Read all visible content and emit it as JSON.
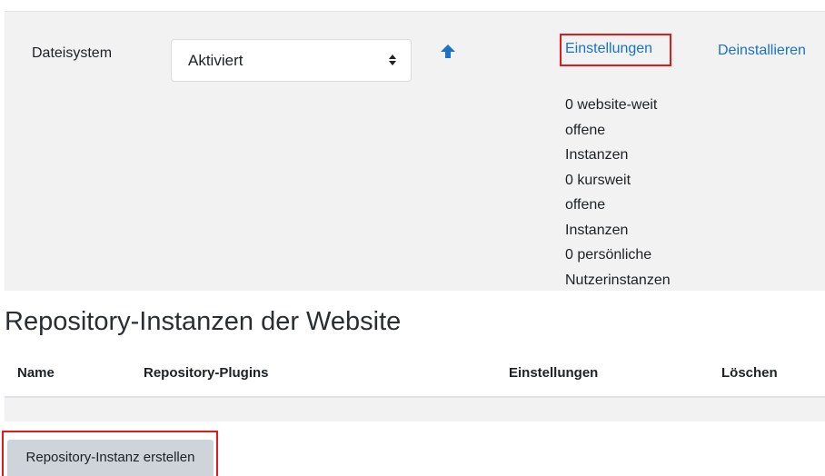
{
  "plugin": {
    "name": "Dateisystem",
    "status_select": {
      "selected": "Aktiviert"
    },
    "settings_link": "Einstellungen",
    "uninstall_link": "Deinstallieren",
    "instances": [
      "0 website-weit",
      "offene",
      "Instanzen",
      "0 kursweit",
      "offene",
      "Instanzen",
      "0 persönliche",
      "Nutzerinstanzen"
    ]
  },
  "site_instances": {
    "title": "Repository-Instanzen der Website",
    "columns": [
      "Name",
      "Repository-Plugins",
      "Einstellungen",
      "Löschen"
    ],
    "rows": []
  },
  "create_button": "Repository-Instanz erstellen",
  "colors": {
    "link": "#1a73c9",
    "highlight": "#e01b1b",
    "row_background": "#f2f2f2",
    "button_background": "#ced4da"
  },
  "icons": {
    "move_up": "arrow-up-icon",
    "select_caret": "sort-caret-icon"
  }
}
